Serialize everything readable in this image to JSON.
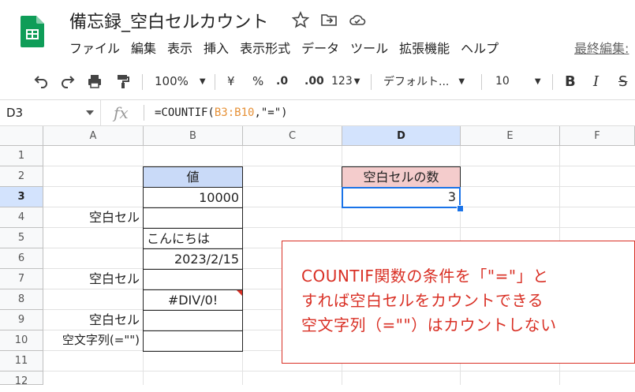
{
  "app": {
    "doc_title": "備忘録_空白セルカウント",
    "menu": [
      "ファイル",
      "編集",
      "表示",
      "挿入",
      "表示形式",
      "データ",
      "ツール",
      "拡張機能",
      "ヘルプ"
    ],
    "last_edit": "最終編集:"
  },
  "toolbar": {
    "zoom": "100%",
    "currency": "¥",
    "percent": "%",
    "dec_decrease": ".0",
    "dec_increase": ".00",
    "number_format": "123",
    "font": "デフォルト...",
    "font_size": "10",
    "bold": "B",
    "italic": "I",
    "strike": "S"
  },
  "formula_bar": {
    "name_box": "D3",
    "fx": "fx",
    "formula_prefix": "=COUNTIF(",
    "formula_ref": "B3:B10",
    "formula_suffix": ",\"=\")"
  },
  "grid": {
    "columns": [
      "A",
      "B",
      "C",
      "D",
      "E",
      "F"
    ],
    "rows": [
      "1",
      "2",
      "3",
      "4",
      "5",
      "6",
      "7",
      "8",
      "9",
      "10",
      "11",
      "12"
    ],
    "selected_cell": "D3",
    "cells": {
      "B2": "値",
      "B3": "10000",
      "A4": "空白セル",
      "B5": "こんにちは",
      "B6": "2023/2/15",
      "A7": "空白セル",
      "B8": "#DIV/0!",
      "A9": "空白セル",
      "A10": "空文字列(=\"\")",
      "D2": "空白セルの数",
      "D3": "3"
    },
    "header_fill_B2": "#c9daf8",
    "header_fill_D2": "#f4cccc",
    "selection_color": "#1a73e8"
  },
  "callout": {
    "lines": [
      "COUNTIF関数の条件を「\"=\"」と",
      "すれば空白セルをカウントできる",
      "空文字列（=\"\"）はカウントしない"
    ],
    "color": "#d93025"
  }
}
